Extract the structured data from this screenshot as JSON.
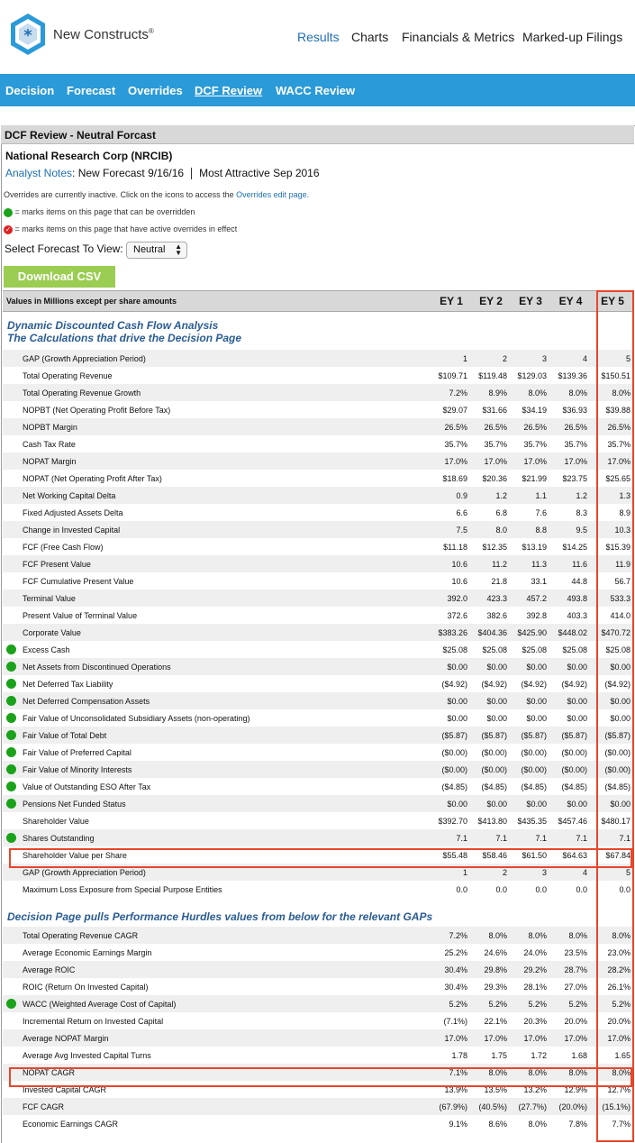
{
  "brand": {
    "name": "New Constructs",
    "mark": "®"
  },
  "top_nav": [
    "Results",
    "Charts",
    "Financials & Metrics",
    "Marked-up Filings"
  ],
  "sub_nav": [
    "Decision",
    "Forecast",
    "Overrides",
    "DCF Review",
    "WACC Review"
  ],
  "panel_title": "DCF Review - Neutral Forcast",
  "company": "National Research Corp (NRCIB)",
  "analyst_notes_link": "Analyst Notes",
  "analyst_notes_text": ": New Forecast 9/16/16",
  "rating_text": "Most Attractive Sep 2016",
  "overrides_note": "Overrides are currently inactive. Click on the icons to access the",
  "overrides_link": "Overrides edit page.",
  "legend_green": "= marks items on this page that can be overridden",
  "legend_red": "= marks items on this page that have active overrides in effect",
  "select_label": "Select Forecast To View:",
  "select_value": "Neutral",
  "download_label": "Download CSV",
  "colors": {
    "accent_bar": "#2b9ad8",
    "link": "#1f6fb2",
    "section": "#2a5c93",
    "highlight": "#e8462b",
    "green": "#1aa21a",
    "button": "#9acd52"
  },
  "table": {
    "header_label": "Values in Millions except per share amounts",
    "columns": [
      "EY 1",
      "EY 2",
      "EY 3",
      "EY 4",
      "EY 5"
    ],
    "section1": "Dynamic Discounted Cash Flow Analysis",
    "section1b": "The Calculations that drive the Decision Page",
    "rows1": [
      {
        "label": "GAP (Growth Appreciation Period)",
        "dot": false,
        "v": [
          "1",
          "2",
          "3",
          "4",
          "5"
        ]
      },
      {
        "label": "Total Operating Revenue",
        "dot": false,
        "v": [
          "$109.71",
          "$119.48",
          "$129.03",
          "$139.36",
          "$150.51"
        ]
      },
      {
        "label": "Total Operating Revenue Growth",
        "dot": false,
        "v": [
          "7.2%",
          "8.9%",
          "8.0%",
          "8.0%",
          "8.0%"
        ]
      },
      {
        "label": "NOPBT (Net Operating Profit Before Tax)",
        "dot": false,
        "v": [
          "$29.07",
          "$31.66",
          "$34.19",
          "$36.93",
          "$39.88"
        ]
      },
      {
        "label": "NOPBT Margin",
        "dot": false,
        "v": [
          "26.5%",
          "26.5%",
          "26.5%",
          "26.5%",
          "26.5%"
        ]
      },
      {
        "label": "Cash Tax Rate",
        "dot": false,
        "v": [
          "35.7%",
          "35.7%",
          "35.7%",
          "35.7%",
          "35.7%"
        ]
      },
      {
        "label": "NOPAT Margin",
        "dot": false,
        "v": [
          "17.0%",
          "17.0%",
          "17.0%",
          "17.0%",
          "17.0%"
        ]
      },
      {
        "label": "NOPAT (Net Operating Profit After Tax)",
        "dot": false,
        "v": [
          "$18.69",
          "$20.36",
          "$21.99",
          "$23.75",
          "$25.65"
        ]
      },
      {
        "label": "Net Working Capital Delta",
        "dot": false,
        "v": [
          "0.9",
          "1.2",
          "1.1",
          "1.2",
          "1.3"
        ]
      },
      {
        "label": "Fixed Adjusted Assets Delta",
        "dot": false,
        "v": [
          "6.6",
          "6.8",
          "7.6",
          "8.3",
          "8.9"
        ]
      },
      {
        "label": "Change in Invested Capital",
        "dot": false,
        "v": [
          "7.5",
          "8.0",
          "8.8",
          "9.5",
          "10.3"
        ]
      },
      {
        "label": "FCF (Free Cash Flow)",
        "dot": false,
        "v": [
          "$11.18",
          "$12.35",
          "$13.19",
          "$14.25",
          "$15.39"
        ]
      },
      {
        "label": "FCF Present Value",
        "dot": false,
        "v": [
          "10.6",
          "11.2",
          "11.3",
          "11.6",
          "11.9"
        ]
      },
      {
        "label": "FCF Cumulative Present Value",
        "dot": false,
        "v": [
          "10.6",
          "21.8",
          "33.1",
          "44.8",
          "56.7"
        ]
      },
      {
        "label": "Terminal Value",
        "dot": false,
        "v": [
          "392.0",
          "423.3",
          "457.2",
          "493.8",
          "533.3"
        ]
      },
      {
        "label": "Present Value of Terminal Value",
        "dot": false,
        "v": [
          "372.6",
          "382.6",
          "392.8",
          "403.3",
          "414.0"
        ]
      },
      {
        "label": "Corporate Value",
        "dot": false,
        "v": [
          "$383.26",
          "$404.36",
          "$425.90",
          "$448.02",
          "$470.72"
        ]
      },
      {
        "label": "Excess Cash",
        "dot": true,
        "v": [
          "$25.08",
          "$25.08",
          "$25.08",
          "$25.08",
          "$25.08"
        ]
      },
      {
        "label": "Net Assets from Discontinued Operations",
        "dot": true,
        "v": [
          "$0.00",
          "$0.00",
          "$0.00",
          "$0.00",
          "$0.00"
        ]
      },
      {
        "label": "Net Deferred Tax Liability",
        "dot": true,
        "v": [
          "($4.92)",
          "($4.92)",
          "($4.92)",
          "($4.92)",
          "($4.92)"
        ]
      },
      {
        "label": "Net Deferred Compensation Assets",
        "dot": true,
        "v": [
          "$0.00",
          "$0.00",
          "$0.00",
          "$0.00",
          "$0.00"
        ]
      },
      {
        "label": "Fair Value of Unconsolidated Subsidiary Assets (non-operating)",
        "dot": true,
        "v": [
          "$0.00",
          "$0.00",
          "$0.00",
          "$0.00",
          "$0.00"
        ]
      },
      {
        "label": "Fair Value of Total Debt",
        "dot": true,
        "v": [
          "($5.87)",
          "($5.87)",
          "($5.87)",
          "($5.87)",
          "($5.87)"
        ]
      },
      {
        "label": "Fair Value of Preferred Capital",
        "dot": true,
        "v": [
          "($0.00)",
          "($0.00)",
          "($0.00)",
          "($0.00)",
          "($0.00)"
        ]
      },
      {
        "label": "Fair Value of Minority Interests",
        "dot": true,
        "v": [
          "($0.00)",
          "($0.00)",
          "($0.00)",
          "($0.00)",
          "($0.00)"
        ]
      },
      {
        "label": "Value of Outstanding ESO After Tax",
        "dot": true,
        "v": [
          "($4.85)",
          "($4.85)",
          "($4.85)",
          "($4.85)",
          "($4.85)"
        ]
      },
      {
        "label": "Pensions Net Funded Status",
        "dot": true,
        "v": [
          "$0.00",
          "$0.00",
          "$0.00",
          "$0.00",
          "$0.00"
        ]
      },
      {
        "label": "Shareholder Value",
        "dot": false,
        "v": [
          "$392.70",
          "$413.80",
          "$435.35",
          "$457.46",
          "$480.17"
        ]
      },
      {
        "label": "Shares Outstanding",
        "dot": true,
        "v": [
          "7.1",
          "7.1",
          "7.1",
          "7.1",
          "7.1"
        ]
      },
      {
        "label": "Shareholder Value per Share",
        "dot": false,
        "v": [
          "$55.48",
          "$58.46",
          "$61.50",
          "$64.63",
          "$67.84"
        ]
      },
      {
        "label": "GAP (Growth Appreciation Period)",
        "dot": false,
        "v": [
          "1",
          "2",
          "3",
          "4",
          "5"
        ]
      },
      {
        "label": "Maximum Loss Exposure from Special Purpose Entities",
        "dot": false,
        "v": [
          "0.0",
          "0.0",
          "0.0",
          "0.0",
          "0.0"
        ]
      }
    ],
    "section2": "Decision Page pulls Performance Hurdles values from below for the relevant GAPs",
    "rows2": [
      {
        "label": "Total Operating Revenue CAGR",
        "dot": false,
        "v": [
          "7.2%",
          "8.0%",
          "8.0%",
          "8.0%",
          "8.0%"
        ]
      },
      {
        "label": "Average Economic Earnings Margin",
        "dot": false,
        "v": [
          "25.2%",
          "24.6%",
          "24.0%",
          "23.5%",
          "23.0%"
        ]
      },
      {
        "label": "Average ROIC",
        "dot": false,
        "v": [
          "30.4%",
          "29.8%",
          "29.2%",
          "28.7%",
          "28.2%"
        ]
      },
      {
        "label": "ROIC (Return On Invested Capital)",
        "dot": false,
        "v": [
          "30.4%",
          "29.3%",
          "28.1%",
          "27.0%",
          "26.1%"
        ]
      },
      {
        "label": "WACC (Weighted Average Cost of Capital)",
        "dot": true,
        "v": [
          "5.2%",
          "5.2%",
          "5.2%",
          "5.2%",
          "5.2%"
        ]
      },
      {
        "label": "Incremental Return on Invested Capital",
        "dot": false,
        "v": [
          "(7.1%)",
          "22.1%",
          "20.3%",
          "20.0%",
          "20.0%"
        ]
      },
      {
        "label": "Average NOPAT Margin",
        "dot": false,
        "v": [
          "17.0%",
          "17.0%",
          "17.0%",
          "17.0%",
          "17.0%"
        ]
      },
      {
        "label": "Average Avg Invested Capital Turns",
        "dot": false,
        "v": [
          "1.78",
          "1.75",
          "1.72",
          "1.68",
          "1.65"
        ]
      },
      {
        "label": "NOPAT CAGR",
        "dot": false,
        "v": [
          "7.1%",
          "8.0%",
          "8.0%",
          "8.0%",
          "8.0%"
        ]
      },
      {
        "label": "Invested Capital CAGR",
        "dot": false,
        "v": [
          "13.9%",
          "13.5%",
          "13.2%",
          "12.9%",
          "12.7%"
        ]
      },
      {
        "label": "FCF CAGR",
        "dot": false,
        "v": [
          "(67.9%)",
          "(40.5%)",
          "(27.7%)",
          "(20.0%)",
          "(15.1%)"
        ]
      },
      {
        "label": "Economic Earnings CAGR",
        "dot": false,
        "v": [
          "9.1%",
          "8.6%",
          "8.0%",
          "7.8%",
          "7.7%"
        ]
      }
    ]
  }
}
